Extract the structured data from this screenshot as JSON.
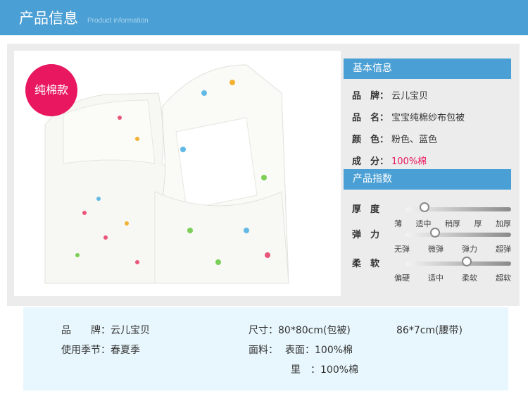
{
  "header": {
    "title": "产品信息",
    "subtitle": "Product information"
  },
  "badge": {
    "label": "纯棉款"
  },
  "basic_info": {
    "heading": "基本信息",
    "rows": [
      {
        "label": "品　牌：",
        "value": "云儿宝贝"
      },
      {
        "label": "品　名：",
        "value": "宝宝纯棉纱布包被"
      },
      {
        "label": "颜　色：",
        "value": "粉色、蓝色"
      },
      {
        "label": "成　分：",
        "value": "100%棉"
      }
    ]
  },
  "indices": {
    "heading": "产品指数",
    "items": [
      {
        "label": "厚　度",
        "ticks": [
          "薄",
          "适中",
          "稍厚",
          "厚",
          "加厚"
        ],
        "selected": "适中",
        "level": 0.18
      },
      {
        "label": "弹　力",
        "ticks": [
          "无弹",
          "微弹",
          "弹力",
          "超弹"
        ],
        "selected": "微弹",
        "level": 0.28
      },
      {
        "label": "柔　软",
        "ticks": [
          "偏硬",
          "适中",
          "柔软",
          "超软"
        ],
        "selected": "柔软",
        "level": 0.58
      }
    ]
  },
  "footer": {
    "brand": "品　　牌：云儿宝贝",
    "season": "使用季节：春夏季",
    "size_label": "尺寸：80*80cm(包被)",
    "size_belt": "86*7cm(腰带)",
    "fabric_label": "面料：",
    "fabric_outer": "表面：100%棉",
    "fabric_inner": "里　：100%棉"
  },
  "colors": {
    "accent": "#4a9fd4",
    "badge": "#e8175f",
    "highlight": "#e8175f",
    "footer_bg": "#e8f7fd"
  }
}
